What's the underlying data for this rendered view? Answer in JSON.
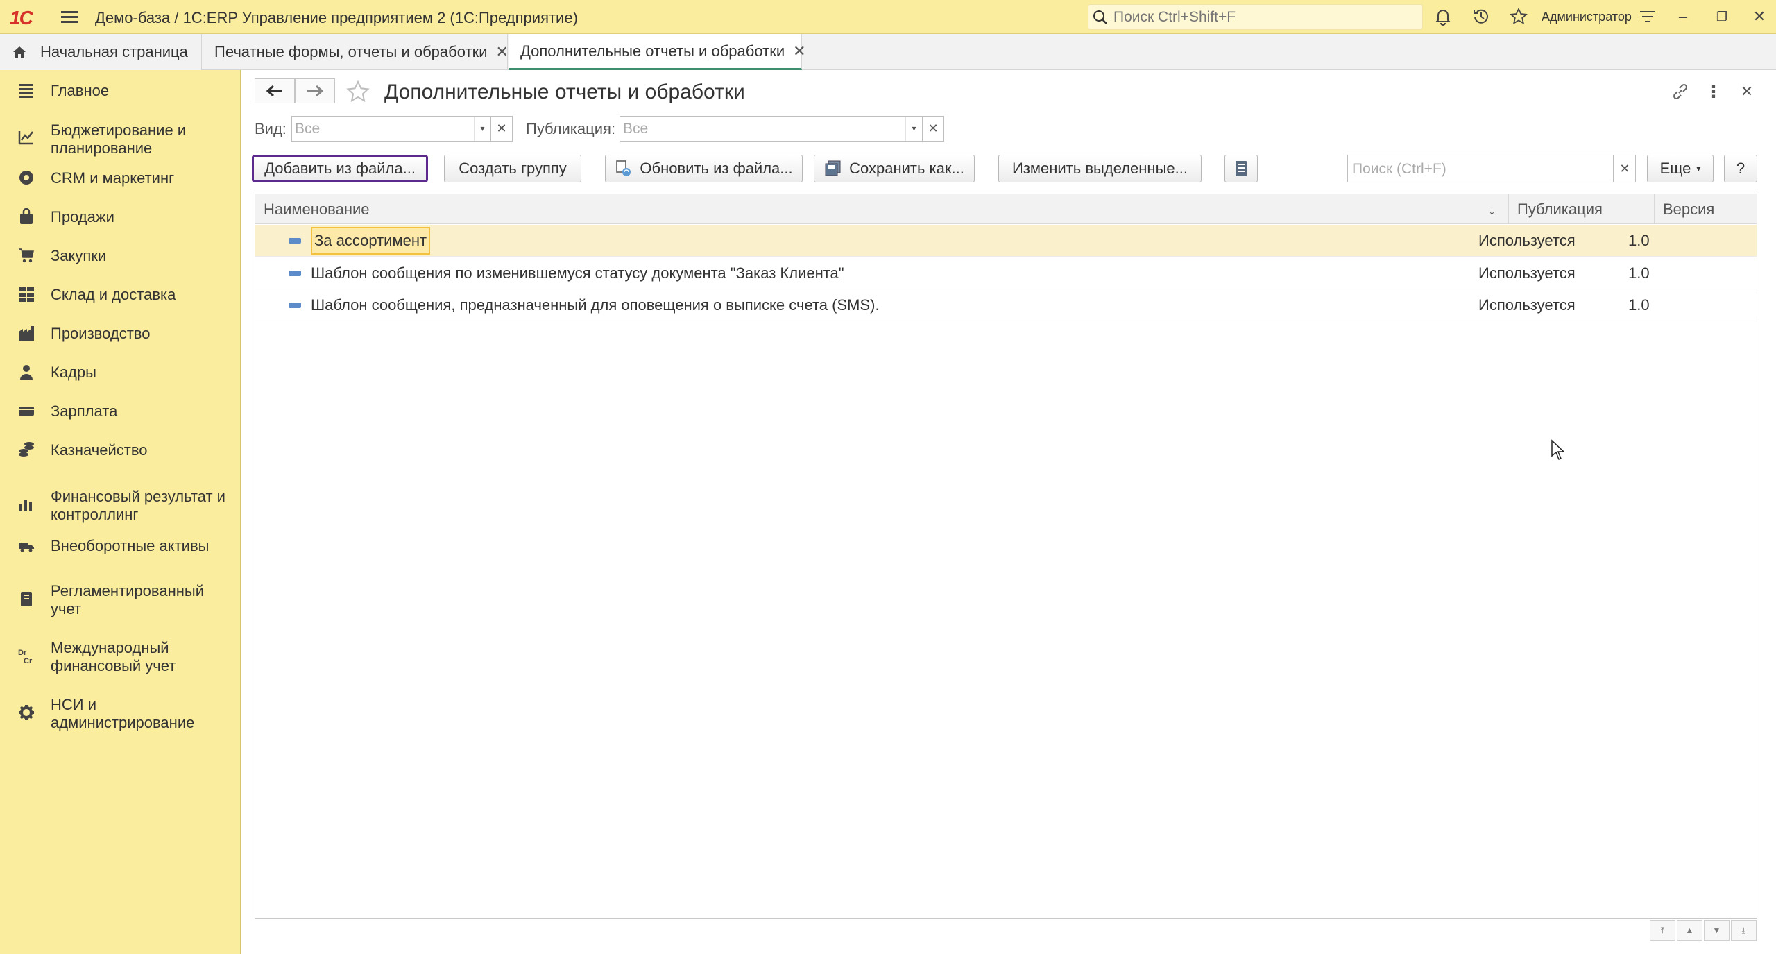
{
  "titlebar": {
    "logo": "1С",
    "title": "Демо-база / 1С:ERP Управление предприятием 2  (1С:Предприятие)",
    "search_placeholder": "Поиск Ctrl+Shift+F",
    "user": "Администратор"
  },
  "tabs": [
    {
      "label": "Начальная страница"
    },
    {
      "label": "Печатные формы, отчеты и обработки"
    },
    {
      "label": "Дополнительные отчеты и обработки"
    }
  ],
  "sidebar": {
    "items": [
      {
        "label": "Главное",
        "icon": "menu-lines-icon"
      },
      {
        "label": "Бюджетирование и планирование",
        "icon": "budget-icon"
      },
      {
        "label": "CRM и маркетинг",
        "icon": "crm-icon"
      },
      {
        "label": "Продажи",
        "icon": "bag-icon"
      },
      {
        "label": "Закупки",
        "icon": "cart-icon"
      },
      {
        "label": "Склад и доставка",
        "icon": "warehouse-icon"
      },
      {
        "label": "Производство",
        "icon": "factory-icon"
      },
      {
        "label": "Кадры",
        "icon": "person-icon"
      },
      {
        "label": "Зарплата",
        "icon": "wallet-icon"
      },
      {
        "label": "Казначейство",
        "icon": "coins-icon"
      },
      {
        "label": "Финансовый результат и контроллинг",
        "icon": "chart-icon"
      },
      {
        "label": "Внеоборотные активы",
        "icon": "truck-icon"
      },
      {
        "label": "Регламентированный учет",
        "icon": "document-lock-icon"
      },
      {
        "label": "Международный финансовый учет",
        "icon": "dr-cr-icon"
      },
      {
        "label": "НСИ и администрирование",
        "icon": "gear-icon"
      }
    ]
  },
  "main": {
    "title": "Дополнительные отчеты и обработки",
    "filters": {
      "kind_label": "Вид:",
      "kind_value": "Все",
      "publication_label": "Публикация:",
      "publication_value": "Все"
    },
    "toolbar": {
      "add_from_file": "Добавить из файла...",
      "create_group": "Создать группу",
      "update_from_file": "Обновить из файла...",
      "save_as": "Сохранить как...",
      "change_selected": "Изменить выделенные...",
      "search_placeholder": "Поиск (Ctrl+F)",
      "more": "Еще",
      "help": "?"
    },
    "table": {
      "columns": [
        "Наименование",
        "Публикация",
        "Версия"
      ],
      "rows": [
        {
          "name": "За ассортимент",
          "publication": "Используется",
          "version": "1.0"
        },
        {
          "name": "Шаблон сообщения по изменившемуся статусу документа \"Заказ Клиента\"",
          "publication": "Используется",
          "version": "1.0"
        },
        {
          "name": "Шаблон сообщения, предназначенный для оповещения о выписке счета (SMS).",
          "publication": "Используется",
          "version": "1.0"
        }
      ]
    }
  },
  "colors": {
    "sidebar_bg": "#fbed9e",
    "active_tab_underline": "#3f8e6f",
    "focus_border": "#5b2a8c",
    "selected_row": "#fbf0cc"
  }
}
